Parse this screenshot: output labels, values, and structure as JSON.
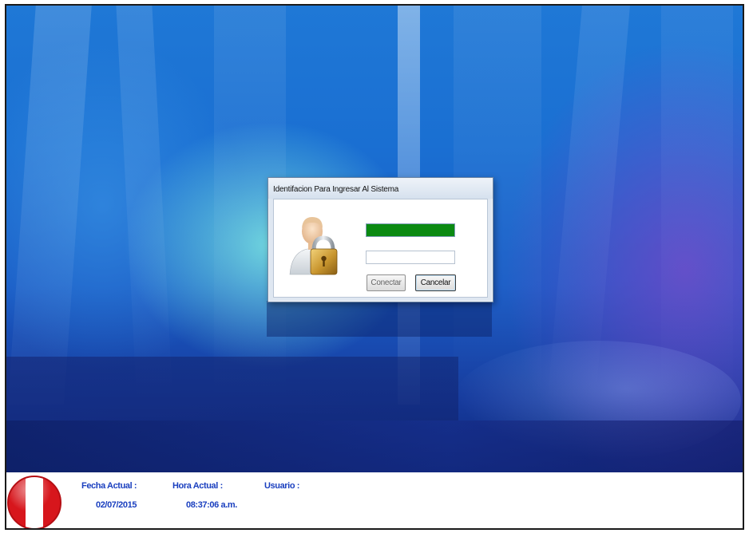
{
  "dialog": {
    "title": "Identifacion Para Ingresar Al Sistema",
    "user_value": "",
    "password_value": "",
    "connect_label": "Conectar",
    "cancel_label": "Cancelar",
    "icon": "user-lock-icon"
  },
  "statusbar": {
    "fecha_label": "Fecha Actual :",
    "fecha_value": "02/07/2015",
    "hora_label": "Hora Actual :",
    "hora_value": "08:37:06 a.m.",
    "usuario_label": "Usuario :",
    "flag_icon": "peru-flag-icon"
  },
  "colors": {
    "user_field_bg": "#0b8a12",
    "status_text": "#1a3fbf",
    "flag_red": "#d7161c"
  }
}
